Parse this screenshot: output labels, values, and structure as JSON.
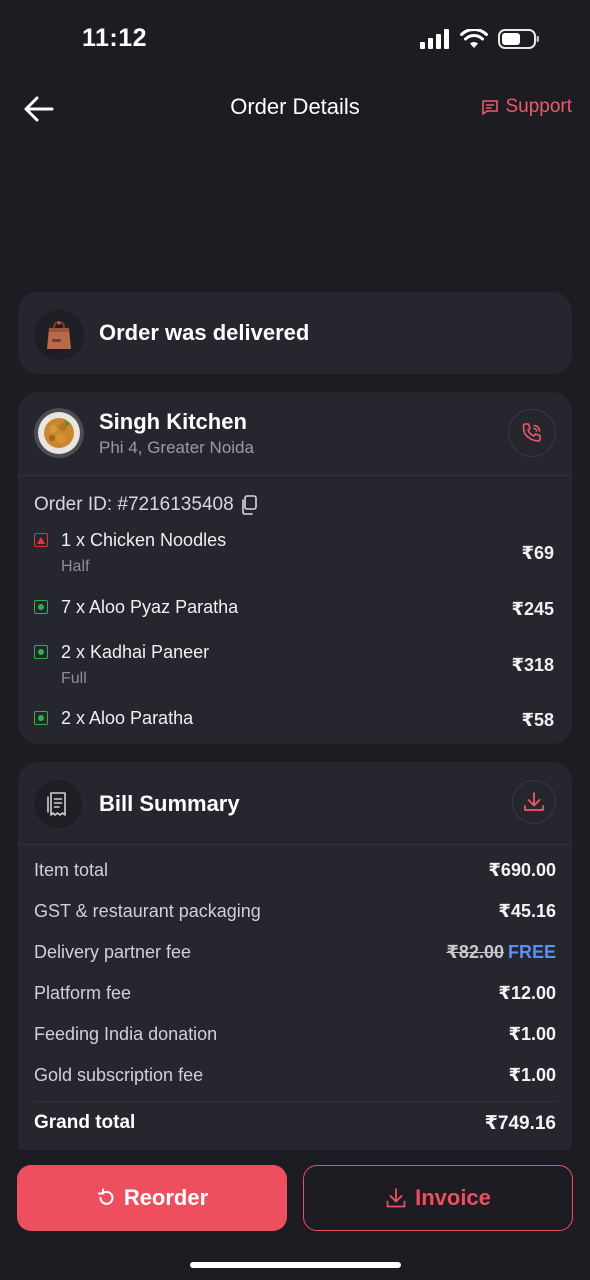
{
  "status_bar": {
    "time": "11:12"
  },
  "header": {
    "title": "Order Details",
    "support_label": "Support"
  },
  "delivery": {
    "status_text": "Order was delivered"
  },
  "restaurant": {
    "name": "Singh Kitchen",
    "location": "Phi 4, Greater Noida"
  },
  "order": {
    "id_text": "Order ID: #7216135408",
    "items": [
      {
        "name": "1 x Chicken Noodles",
        "variant": "Half",
        "price": "₹69",
        "type": "non-veg"
      },
      {
        "name": "7 x Aloo Pyaz Paratha",
        "variant": "",
        "price": "₹245",
        "type": "veg"
      },
      {
        "name": "2 x Kadhai Paneer",
        "variant": "Full",
        "price": "₹318",
        "type": "veg"
      },
      {
        "name": "2 x Aloo Paratha",
        "variant": "",
        "price": "₹58",
        "type": "veg"
      }
    ]
  },
  "bill": {
    "title": "Bill Summary",
    "rows": [
      {
        "label": "Item total",
        "value": "₹690.00"
      },
      {
        "label": "GST & restaurant packaging",
        "value": "₹45.16"
      },
      {
        "label": "Delivery partner fee",
        "original": "₹82.00",
        "value": "FREE"
      },
      {
        "label": "Platform fee",
        "value": "₹12.00"
      },
      {
        "label": "Feeding India donation",
        "value": "₹1.00"
      },
      {
        "label": "Gold subscription fee",
        "value": "₹1.00"
      }
    ],
    "grand_total_label": "Grand total",
    "grand_total_value": "₹749.16"
  },
  "actions": {
    "reorder_label": "Reorder",
    "invoice_label": "Invoice"
  },
  "colors": {
    "accent": "#ee4f5f",
    "background": "#1c1c22",
    "card": "#26262e",
    "free": "#5b8ff0",
    "veg": "#2fb14f",
    "nonveg": "#e0333f"
  }
}
